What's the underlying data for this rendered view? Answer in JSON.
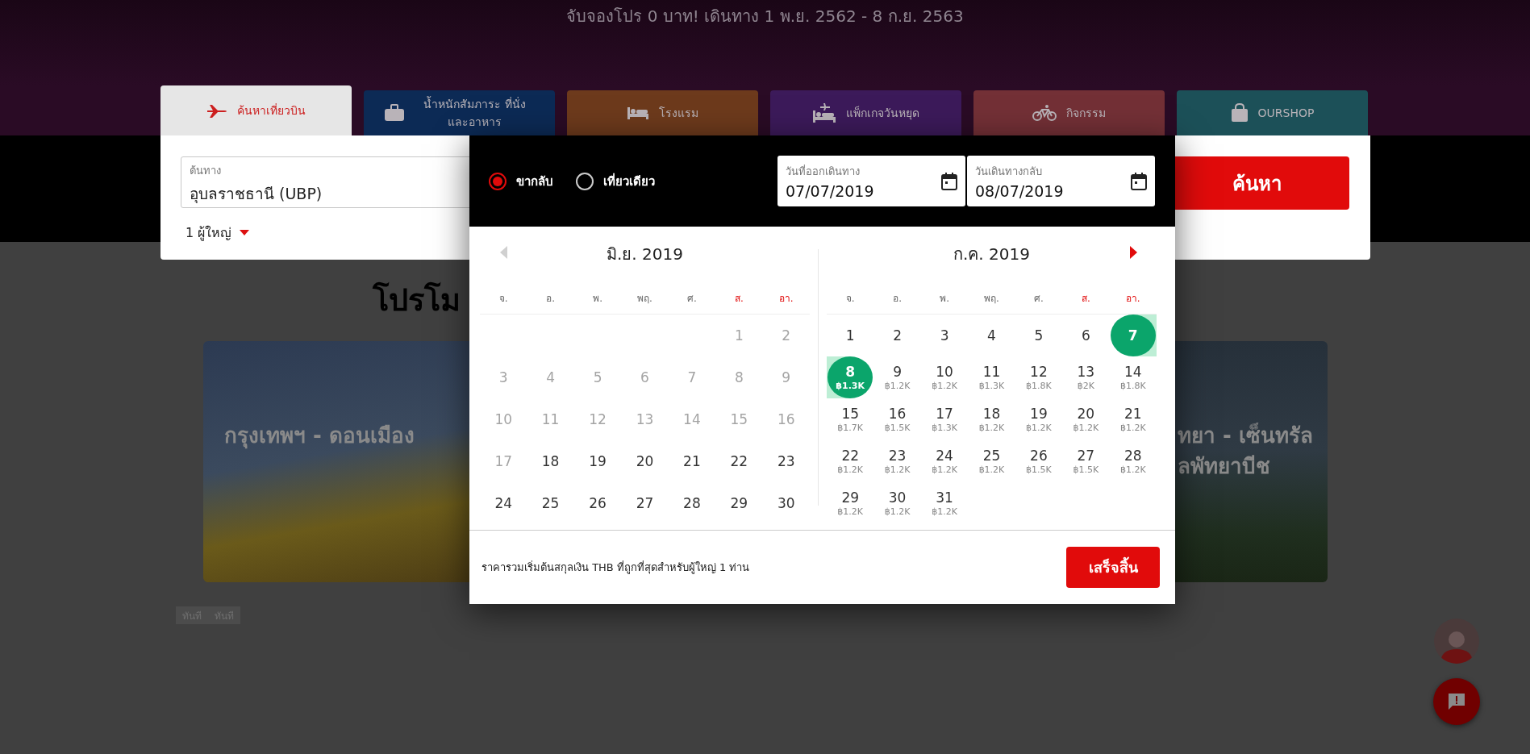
{
  "header": {
    "headline": "จับจองโปร 0 บาท! เดินทาง 1 พ.ย. 2562 - 8 ก.ย. 2563"
  },
  "tabs": [
    {
      "label": "ค้นหาเที่ยวบิน",
      "kind": "flight",
      "selected": true
    },
    {
      "label": "น้ำหนักสัมภาระ ที่นั่ง และอาหาร",
      "kind": "baggage",
      "selected": false
    },
    {
      "label": "โรงแรม",
      "kind": "hotel",
      "selected": false
    },
    {
      "label": "แพ็กเกจวันหยุด",
      "kind": "package",
      "selected": false
    },
    {
      "label": "กิจกรรม",
      "kind": "activity",
      "selected": false
    },
    {
      "label": "OURSHOP",
      "kind": "shop",
      "selected": false
    }
  ],
  "search": {
    "origin": {
      "label": "ต้นทาง",
      "value": "อุบลราชธานี (UBP)"
    },
    "passengers": "1 ผู้ใหญ่",
    "search_button": "ค้นหา"
  },
  "promotions": {
    "heading": "โปรโม",
    "cards": [
      {
        "lines": [
          "กรุงเทพฯ - ดอนเมือง"
        ]
      },
      {
        "lines": [
          "ทยา - เซ็นทรัล",
          "ลพัทยาบีช"
        ]
      }
    ],
    "buttons": [
      "ทันที",
      "ทันที"
    ]
  },
  "date_picker": {
    "trip_types": [
      {
        "label": "ขากลับ",
        "selected": true
      },
      {
        "label": "เที่ยวเดียว",
        "selected": false
      }
    ],
    "dates": [
      {
        "label": "วันที่ออกเดินทาง",
        "value": "07/07/2019"
      },
      {
        "label": "วันเดินทางกลับ",
        "value": "08/07/2019"
      }
    ],
    "months": [
      {
        "title": "มิ.ย. 2019",
        "nav": {
          "kind": "prev",
          "enabled": false
        },
        "weekdays": [
          {
            "label": "จ.",
            "weekend": false
          },
          {
            "label": "อ.",
            "weekend": false
          },
          {
            "label": "พ.",
            "weekend": false
          },
          {
            "label": "พฤ.",
            "weekend": false
          },
          {
            "label": "ศ.",
            "weekend": false
          },
          {
            "label": "ส.",
            "weekend": true
          },
          {
            "label": "อา.",
            "weekend": true
          }
        ],
        "weeks": [
          [
            {
              "kind": "blank"
            },
            {
              "kind": "blank"
            },
            {
              "kind": "blank"
            },
            {
              "kind": "blank"
            },
            {
              "kind": "blank"
            },
            {
              "day": "1",
              "disabled": true,
              "selected": false
            },
            {
              "day": "2",
              "disabled": true,
              "selected": false
            }
          ],
          [
            {
              "day": "3",
              "disabled": true,
              "selected": false
            },
            {
              "day": "4",
              "disabled": true,
              "selected": false
            },
            {
              "day": "5",
              "disabled": true,
              "selected": false
            },
            {
              "day": "6",
              "disabled": true,
              "selected": false
            },
            {
              "day": "7",
              "disabled": true,
              "selected": false
            },
            {
              "day": "8",
              "disabled": true,
              "selected": false
            },
            {
              "day": "9",
              "disabled": true,
              "selected": false
            }
          ],
          [
            {
              "day": "10",
              "disabled": true,
              "selected": false
            },
            {
              "day": "11",
              "disabled": true,
              "selected": false
            },
            {
              "day": "12",
              "disabled": true,
              "selected": false
            },
            {
              "day": "13",
              "disabled": true,
              "selected": false
            },
            {
              "day": "14",
              "disabled": true,
              "selected": false
            },
            {
              "day": "15",
              "disabled": true,
              "selected": false
            },
            {
              "day": "16",
              "disabled": true,
              "selected": false
            }
          ],
          [
            {
              "day": "17",
              "disabled": true,
              "selected": false
            },
            {
              "day": "18",
              "disabled": false,
              "selected": false
            },
            {
              "day": "19",
              "disabled": false,
              "selected": false
            },
            {
              "day": "20",
              "disabled": false,
              "selected": false
            },
            {
              "day": "21",
              "disabled": false,
              "selected": false
            },
            {
              "day": "22",
              "disabled": false,
              "selected": false
            },
            {
              "day": "23",
              "disabled": false,
              "selected": false
            }
          ],
          [
            {
              "day": "24",
              "disabled": false,
              "selected": false
            },
            {
              "day": "25",
              "disabled": false,
              "selected": false
            },
            {
              "day": "26",
              "disabled": false,
              "selected": false
            },
            {
              "day": "27",
              "disabled": false,
              "selected": false
            },
            {
              "day": "28",
              "disabled": false,
              "selected": false
            },
            {
              "day": "29",
              "disabled": false,
              "selected": false
            },
            {
              "day": "30",
              "disabled": false,
              "selected": false
            }
          ]
        ]
      },
      {
        "title": "ก.ค. 2019",
        "nav": {
          "kind": "next",
          "enabled": true
        },
        "weekdays": [
          {
            "label": "จ.",
            "weekend": false
          },
          {
            "label": "อ.",
            "weekend": false
          },
          {
            "label": "พ.",
            "weekend": false
          },
          {
            "label": "พฤ.",
            "weekend": false
          },
          {
            "label": "ศ.",
            "weekend": false
          },
          {
            "label": "ส.",
            "weekend": true
          },
          {
            "label": "อา.",
            "weekend": true
          }
        ],
        "weeks": [
          [
            {
              "day": "1",
              "disabled": false,
              "selected": false
            },
            {
              "day": "2",
              "disabled": false,
              "selected": false
            },
            {
              "day": "3",
              "disabled": false,
              "selected": false
            },
            {
              "day": "4",
              "disabled": false,
              "selected": false
            },
            {
              "day": "5",
              "disabled": false,
              "selected": false
            },
            {
              "day": "6",
              "disabled": false,
              "selected": false
            },
            {
              "day": "7",
              "disabled": false,
              "selected": true
            }
          ],
          [
            {
              "day": "8",
              "price": "฿1.3K",
              "disabled": false,
              "selected": true
            },
            {
              "day": "9",
              "price": "฿1.2K",
              "disabled": false,
              "selected": false
            },
            {
              "day": "10",
              "price": "฿1.2K",
              "disabled": false,
              "selected": false
            },
            {
              "day": "11",
              "price": "฿1.3K",
              "disabled": false,
              "selected": false
            },
            {
              "day": "12",
              "price": "฿1.8K",
              "disabled": false,
              "selected": false
            },
            {
              "day": "13",
              "price": "฿2K",
              "disabled": false,
              "selected": false
            },
            {
              "day": "14",
              "price": "฿1.8K",
              "disabled": false,
              "selected": false
            }
          ],
          [
            {
              "day": "15",
              "price": "฿1.7K",
              "disabled": false,
              "selected": false
            },
            {
              "day": "16",
              "price": "฿1.5K",
              "disabled": false,
              "selected": false
            },
            {
              "day": "17",
              "price": "฿1.3K",
              "disabled": false,
              "selected": false
            },
            {
              "day": "18",
              "price": "฿1.2K",
              "disabled": false,
              "selected": false
            },
            {
              "day": "19",
              "price": "฿1.2K",
              "disabled": false,
              "selected": false
            },
            {
              "day": "20",
              "price": "฿1.2K",
              "disabled": false,
              "selected": false
            },
            {
              "day": "21",
              "price": "฿1.2K",
              "disabled": false,
              "selected": false
            }
          ],
          [
            {
              "day": "22",
              "price": "฿1.2K",
              "disabled": false,
              "selected": false
            },
            {
              "day": "23",
              "price": "฿1.2K",
              "disabled": false,
              "selected": false
            },
            {
              "day": "24",
              "price": "฿1.2K",
              "disabled": false,
              "selected": false
            },
            {
              "day": "25",
              "price": "฿1.2K",
              "disabled": false,
              "selected": false
            },
            {
              "day": "26",
              "price": "฿1.5K",
              "disabled": false,
              "selected": false
            },
            {
              "day": "27",
              "price": "฿1.5K",
              "disabled": false,
              "selected": false
            },
            {
              "day": "28",
              "price": "฿1.2K",
              "disabled": false,
              "selected": false
            }
          ],
          [
            {
              "day": "29",
              "price": "฿1.2K",
              "disabled": false,
              "selected": false
            },
            {
              "day": "30",
              "price": "฿1.2K",
              "disabled": false,
              "selected": false
            },
            {
              "day": "31",
              "price": "฿1.2K",
              "disabled": false,
              "selected": false
            }
          ]
        ]
      }
    ],
    "note": "ราคารวมเริ่มต้นสกุลเงิน THB ที่ถูกที่สุดสำหรับผู้ใหญ่ 1 ท่าน",
    "done_button": "เสร็จสิ้น"
  }
}
